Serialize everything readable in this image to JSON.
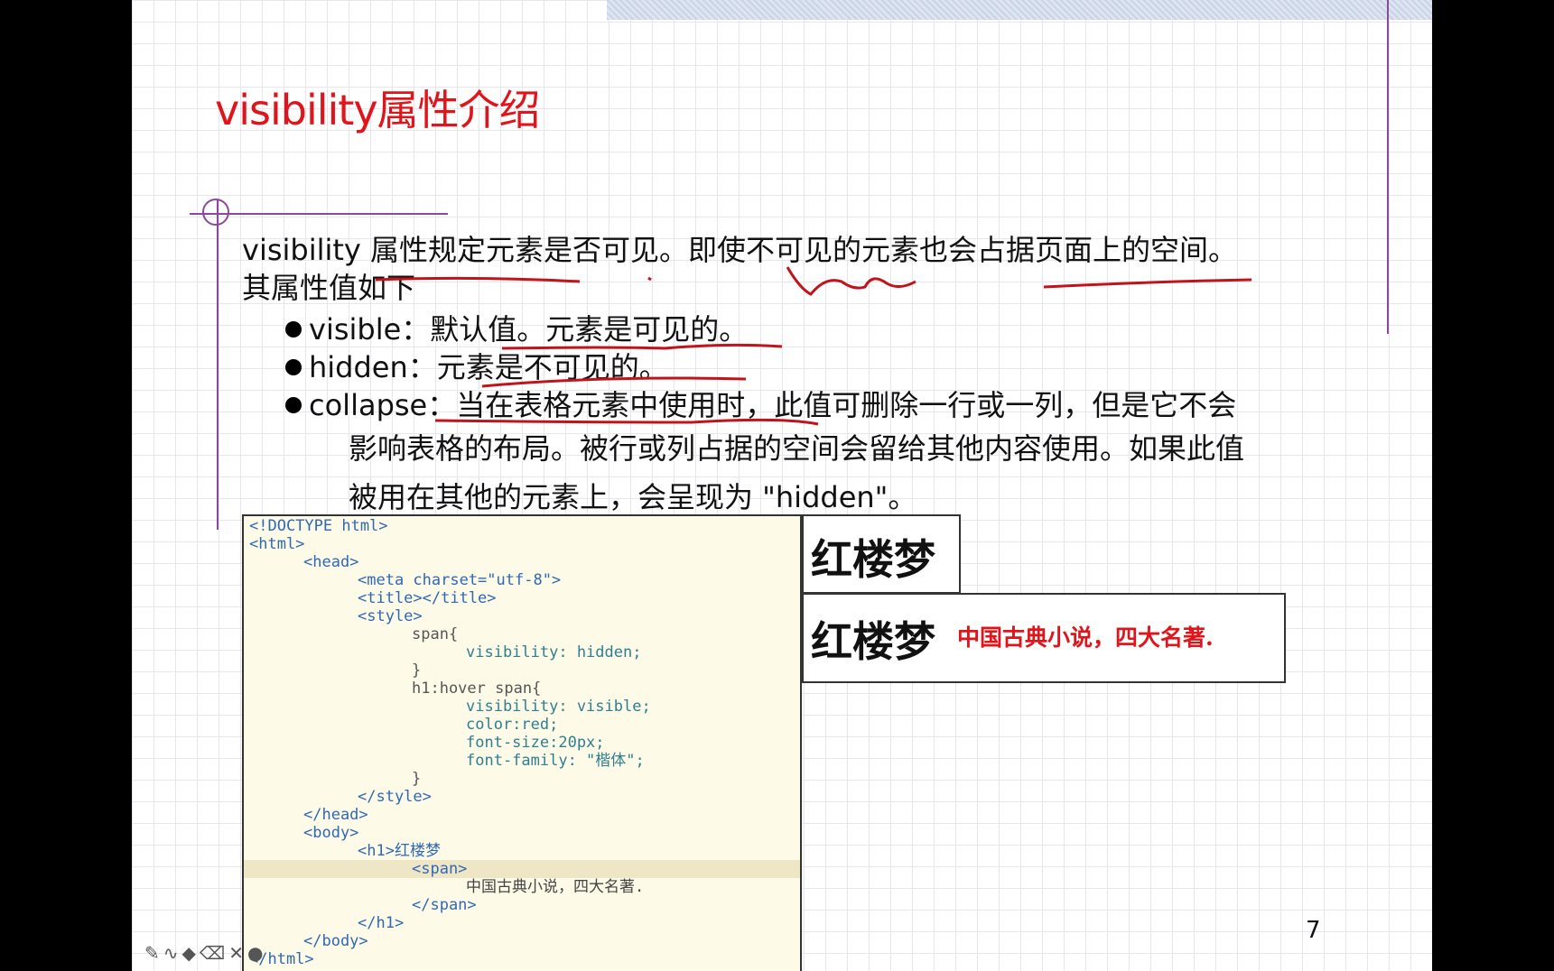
{
  "slide": {
    "title": "visibility属性介绍",
    "intro_line1": "visibility 属性规定元素是否可见。即使不可见的元素也会占据页面上的空间。",
    "intro_line2": "其属性值如下",
    "bullets": [
      {
        "label": "visible：默认值。元素是可见的。"
      },
      {
        "label": "hidden：元素是不可见的。"
      },
      {
        "label": "collapse：当在表格元素中使用时，此值可删除一行或一列，但是它不会"
      }
    ],
    "bullet3_cont1": "影响表格的布局。被行或列占据的空间会留给其他内容使用。如果此值",
    "bullet3_cont2": "被用在其他的元素上，会呈现为 \"hidden\"。",
    "page_number": "7"
  },
  "code": {
    "lines": [
      "<!DOCTYPE html>",
      "<html>",
      "<head>",
      "<meta charset=\"utf-8\">",
      "<title></title>",
      "<style>",
      "span{",
      "visibility: hidden;",
      "}",
      "h1:hover span{",
      "visibility: visible;",
      "color:red;",
      "font-size:20px;",
      "font-family: \"楷体\";",
      "}",
      "</style>",
      "</head>",
      "<body>",
      "<h1>红楼梦",
      "<span>",
      "中国古典小说，四大名著.",
      "</span>",
      "</h1>",
      "</body>",
      "</html>"
    ]
  },
  "output": {
    "h1_text": "红楼梦",
    "h1_text_hover": "红楼梦",
    "span_text": "中国古典小说，四大名著."
  },
  "colors": {
    "title": "#e0141b",
    "annotation": "#c0141b",
    "frame_line": "#8a4a9a"
  },
  "toolbar": {
    "icons": [
      "pen-icon",
      "curve-icon",
      "highlighter-icon",
      "eraser-icon",
      "close-icon",
      "laser-pointer-icon"
    ]
  }
}
